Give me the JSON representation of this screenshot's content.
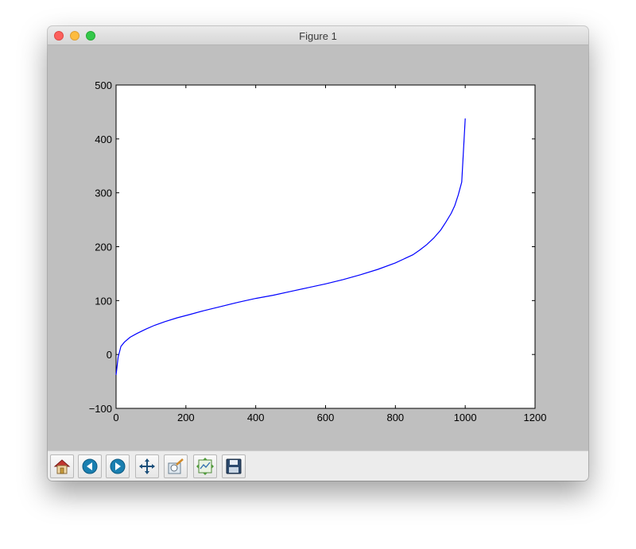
{
  "window": {
    "title": "Figure 1"
  },
  "toolbar": {
    "buttons": [
      {
        "name": "home",
        "icon": "home-icon"
      },
      {
        "name": "back",
        "icon": "back-arrow-icon"
      },
      {
        "name": "forward",
        "icon": "forward-arrow-icon"
      },
      {
        "name": "pan",
        "icon": "pan-move-icon"
      },
      {
        "name": "zoom",
        "icon": "zoom-rect-icon"
      },
      {
        "name": "subplots",
        "icon": "configure-subplots-icon"
      },
      {
        "name": "save",
        "icon": "save-floppy-icon"
      }
    ]
  },
  "chart_data": {
    "type": "line",
    "title": "",
    "xlabel": "",
    "ylabel": "",
    "xlim": [
      0,
      1200
    ],
    "ylim": [
      -100,
      500
    ],
    "xticks": [
      "0",
      "200",
      "400",
      "600",
      "800",
      "1000",
      "1200"
    ],
    "yticks": [
      "−100",
      "0",
      "100",
      "200",
      "300",
      "400",
      "500"
    ],
    "grid": false,
    "series": [
      {
        "color": "#0000ff",
        "x": [
          0,
          6,
          14,
          24,
          40,
          60,
          85,
          110,
          140,
          175,
          210,
          250,
          300,
          350,
          400,
          450,
          500,
          550,
          600,
          650,
          700,
          750,
          800,
          850,
          870,
          890,
          910,
          930,
          945,
          960,
          970,
          980,
          990,
          1000
        ],
        "y": [
          -38,
          -5,
          15,
          23,
          32,
          39,
          47,
          54,
          61,
          68,
          74,
          81,
          89,
          97,
          104,
          110,
          117,
          124,
          131,
          139,
          148,
          158,
          170,
          185,
          194,
          204,
          216,
          231,
          246,
          262,
          276,
          296,
          320,
          438
        ]
      }
    ]
  }
}
